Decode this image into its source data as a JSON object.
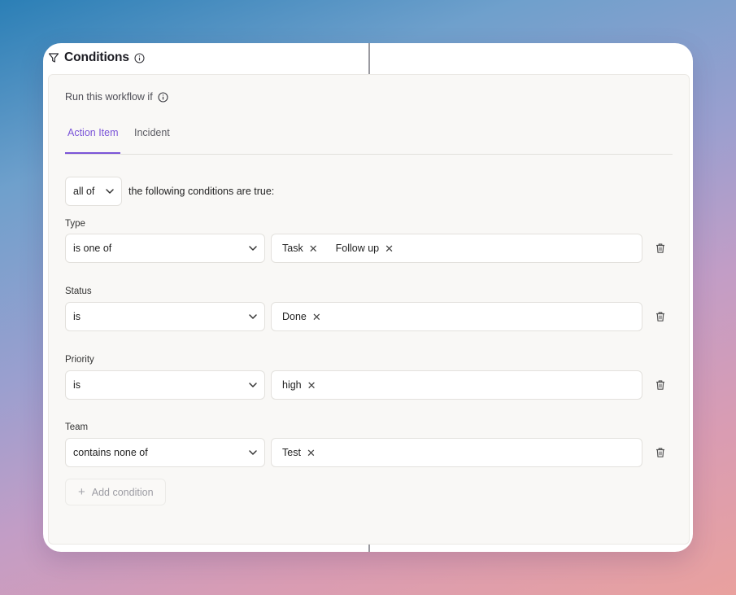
{
  "header": {
    "title": "Conditions",
    "filter_icon": "filter-icon",
    "info_icon": "info-icon"
  },
  "panel": {
    "run_label": "Run this workflow if",
    "tabs": [
      {
        "label": "Action Item",
        "active": true
      },
      {
        "label": "Incident",
        "active": false
      }
    ],
    "match": {
      "selected": "all of",
      "text": "the following conditions are true:"
    },
    "conditions": [
      {
        "label": "Type",
        "operator": "is one of",
        "values": [
          "Task",
          "Follow up"
        ]
      },
      {
        "label": "Status",
        "operator": "is",
        "values": [
          "Done"
        ]
      },
      {
        "label": "Priority",
        "operator": "is",
        "values": [
          "high"
        ]
      },
      {
        "label": "Team",
        "operator": "contains none of",
        "values": [
          "Test"
        ]
      }
    ],
    "add_condition_label": "Add condition"
  },
  "colors": {
    "accent": "#7b55d8",
    "panel_bg": "#f9f8f6",
    "border": "#e3e1dd"
  }
}
